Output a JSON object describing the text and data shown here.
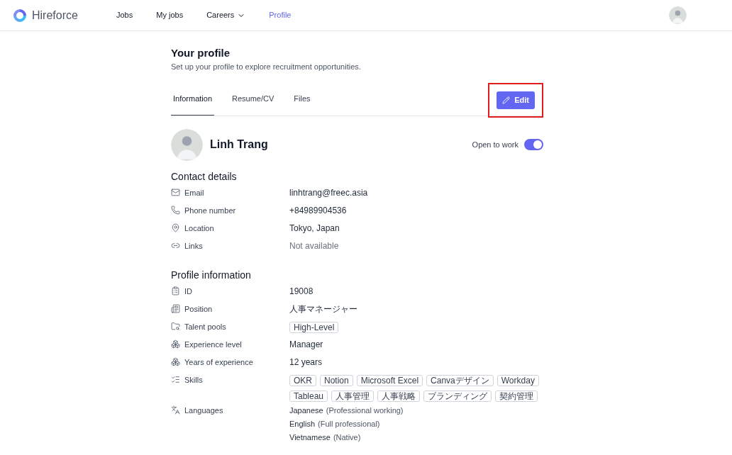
{
  "brand": {
    "name": "Hireforce"
  },
  "nav": [
    {
      "label": "Jobs",
      "selected": false,
      "dropdown": false
    },
    {
      "label": "My jobs",
      "selected": false,
      "dropdown": false
    },
    {
      "label": "Careers",
      "selected": false,
      "dropdown": true
    },
    {
      "label": "Profile",
      "selected": true,
      "dropdown": false
    }
  ],
  "page": {
    "title": "Your profile",
    "subtitle": "Set up your profile to explore recruitment opportunities."
  },
  "tabs": [
    {
      "label": "Information",
      "selected": true
    },
    {
      "label": "Resume/CV",
      "selected": false
    },
    {
      "label": "Files",
      "selected": false
    }
  ],
  "edit_button": {
    "label": "Edit",
    "highlighted": true
  },
  "profile": {
    "name": "Linh Trang",
    "open_to_work": {
      "label": "Open to work",
      "on": true
    }
  },
  "sections": [
    {
      "title": "Contact details",
      "rows": [
        {
          "label": "Email",
          "kind": "text",
          "value": "linhtrang@freec.asia",
          "muted": false
        },
        {
          "label": "Phone number",
          "kind": "text",
          "value": "+84989904536",
          "muted": false
        },
        {
          "label": "Location",
          "kind": "text",
          "value": "Tokyo, Japan",
          "muted": false
        },
        {
          "label": "Links",
          "kind": "text",
          "value": "Not available",
          "muted": true
        }
      ]
    },
    {
      "title": "Profile information",
      "rows": [
        {
          "label": "ID",
          "kind": "text",
          "value": "19008",
          "muted": false
        },
        {
          "label": "Position",
          "kind": "text",
          "value": "人事マネージャー",
          "muted": false
        },
        {
          "label": "Talent pools",
          "kind": "tags",
          "tags": [
            "High-Level"
          ]
        },
        {
          "label": "Experience level",
          "kind": "text",
          "value": "Manager",
          "muted": false
        },
        {
          "label": "Years of experience",
          "kind": "text",
          "value": "12 years",
          "muted": false
        },
        {
          "label": "Skills",
          "kind": "tags",
          "tags": [
            "OKR",
            "Notion",
            "Microsoft Excel",
            "Canvaデザイン",
            "Workday",
            "Tableau",
            "人事管理",
            "人事戦略",
            "ブランディング",
            "契約管理"
          ]
        },
        {
          "label": "Languages",
          "kind": "languages",
          "languages": [
            {
              "name": "Japanese",
              "level": "(Professional working)"
            },
            {
              "name": "English",
              "level": "(Full professional)"
            },
            {
              "name": "Vietnamese",
              "level": "(Native)"
            }
          ]
        }
      ]
    }
  ]
}
